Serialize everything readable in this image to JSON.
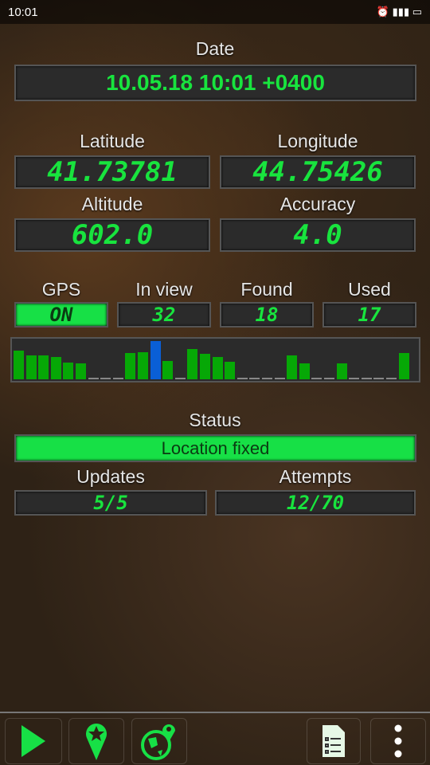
{
  "status_bar": {
    "time": "10:01"
  },
  "date": {
    "label": "Date",
    "value": "10.05.18 10:01 +0400"
  },
  "latitude": {
    "label": "Latitude",
    "value": "41.73781"
  },
  "longitude": {
    "label": "Longitude",
    "value": "44.75426"
  },
  "altitude": {
    "label": "Altitude",
    "value": "602.0"
  },
  "accuracy": {
    "label": "Accuracy",
    "value": "4.0"
  },
  "gps": {
    "label": "GPS",
    "value": "ON"
  },
  "in_view": {
    "label": "In view",
    "value": "32"
  },
  "found": {
    "label": "Found",
    "value": "18"
  },
  "used": {
    "label": "Used",
    "value": "17"
  },
  "satellite_signal": {
    "values": [
      37,
      31,
      31,
      29,
      22,
      21,
      0,
      0,
      0,
      34,
      35,
      50,
      24,
      0,
      40,
      33,
      29,
      23,
      0,
      0,
      0,
      0,
      31,
      21,
      0,
      0,
      21,
      0,
      0,
      0,
      0,
      34
    ],
    "highlighted_index": 11,
    "colors": {
      "normal": "#06a806",
      "highlight": "#0a5fd6"
    }
  },
  "status": {
    "label": "Status",
    "value": "Location fixed",
    "color": "#17e046"
  },
  "updates": {
    "label": "Updates",
    "value": "5/5"
  },
  "attempts": {
    "label": "Attempts",
    "value": "12/70"
  },
  "toolbar": {
    "icons": [
      "play-icon",
      "star-pin-icon",
      "globe-pin-icon",
      "list-document-icon",
      "more-vert-icon"
    ]
  }
}
